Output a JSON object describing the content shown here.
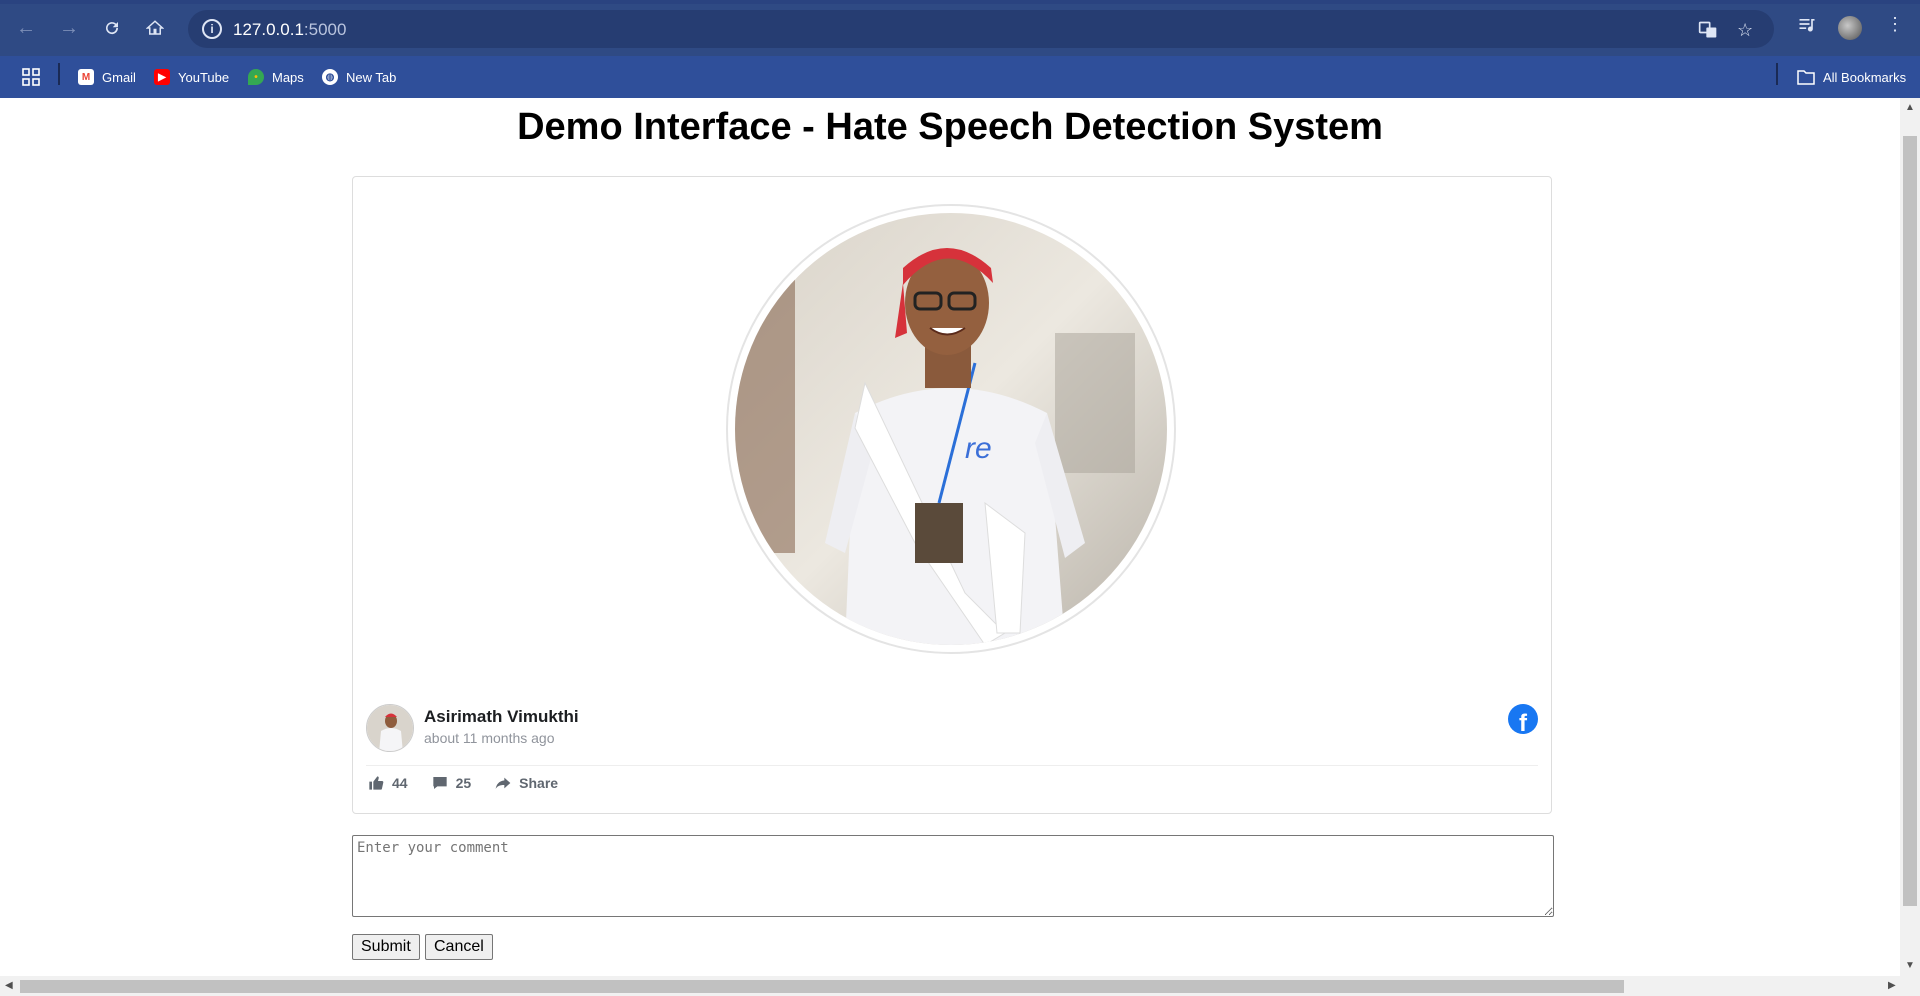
{
  "browser": {
    "url_host": "127.0.0.1",
    "url_port": ":5000",
    "bookmarks": [
      {
        "label": "Gmail",
        "icon": "gmail-icon"
      },
      {
        "label": "YouTube",
        "icon": "youtube-icon"
      },
      {
        "label": "Maps",
        "icon": "maps-icon"
      },
      {
        "label": "New Tab",
        "icon": "globe-icon"
      }
    ],
    "all_bookmarks_label": "All Bookmarks",
    "colors": {
      "chrome": "#2f4a84",
      "bookmarks_bar": "#2f4f9a",
      "omnibox": "#263d72"
    }
  },
  "page": {
    "title": "Demo Interface - Hate Speech Detection System"
  },
  "post": {
    "author": "Asirimath Vimukthi",
    "time": "about 11 months ago",
    "likes": "44",
    "comments": "25",
    "share_label": "Share",
    "network_icon": "facebook-icon",
    "facebook_glyph": "f"
  },
  "comment_form": {
    "placeholder": "Enter your comment",
    "value": "",
    "submit_label": "Submit",
    "cancel_label": "Cancel"
  }
}
